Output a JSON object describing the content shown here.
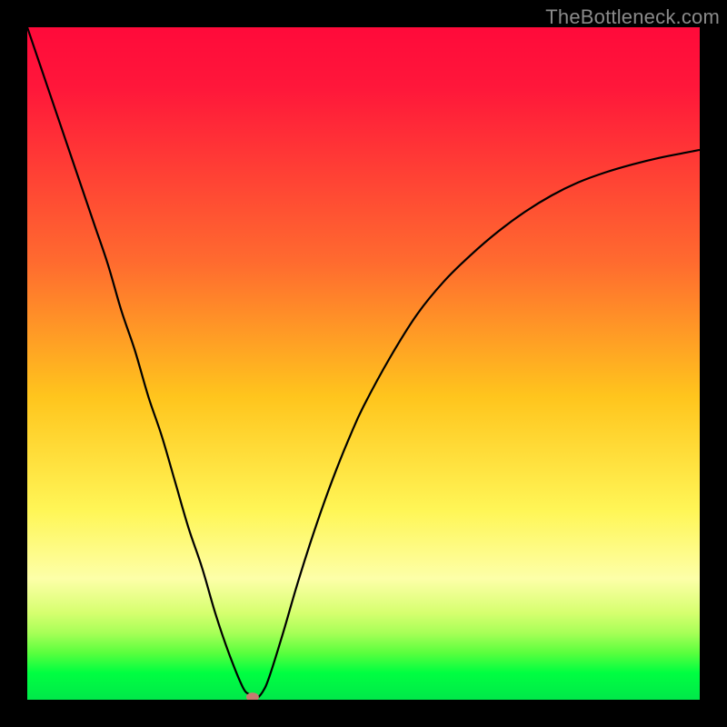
{
  "watermark": "TheBottleneck.com",
  "chart_data": {
    "type": "line",
    "title": "",
    "xlabel": "",
    "ylabel": "",
    "xlim": [
      0,
      100
    ],
    "ylim": [
      0,
      102
    ],
    "grid": false,
    "legend": false,
    "background_gradient": {
      "top": "#ff0a3a",
      "middle": "#fff657",
      "bottom": "#00e84a"
    },
    "series": [
      {
        "name": "bottleneck-curve",
        "color": "#000000",
        "x": [
          0,
          2,
          4,
          6,
          8,
          10,
          12,
          14,
          16,
          18,
          20,
          22,
          24,
          26,
          28,
          30,
          32,
          33,
          34,
          35,
          36,
          38,
          40,
          42,
          44,
          46,
          48,
          50,
          54,
          58,
          62,
          66,
          70,
          74,
          78,
          82,
          86,
          90,
          94,
          98,
          100
        ],
        "y": [
          102,
          96,
          90,
          84,
          78,
          72,
          66,
          59,
          53,
          46,
          40,
          33,
          26,
          20,
          13,
          7,
          2,
          0.8,
          0.2,
          1.2,
          3.5,
          10,
          17,
          23.5,
          29.5,
          35,
          40,
          44.5,
          52,
          58.5,
          63.5,
          67.5,
          71,
          74,
          76.5,
          78.5,
          80,
          81.2,
          82.2,
          83,
          83.4
        ]
      }
    ],
    "markers": [
      {
        "name": "optimal-point",
        "x": 33.5,
        "y": 0.4,
        "color": "#c77a70"
      }
    ]
  }
}
